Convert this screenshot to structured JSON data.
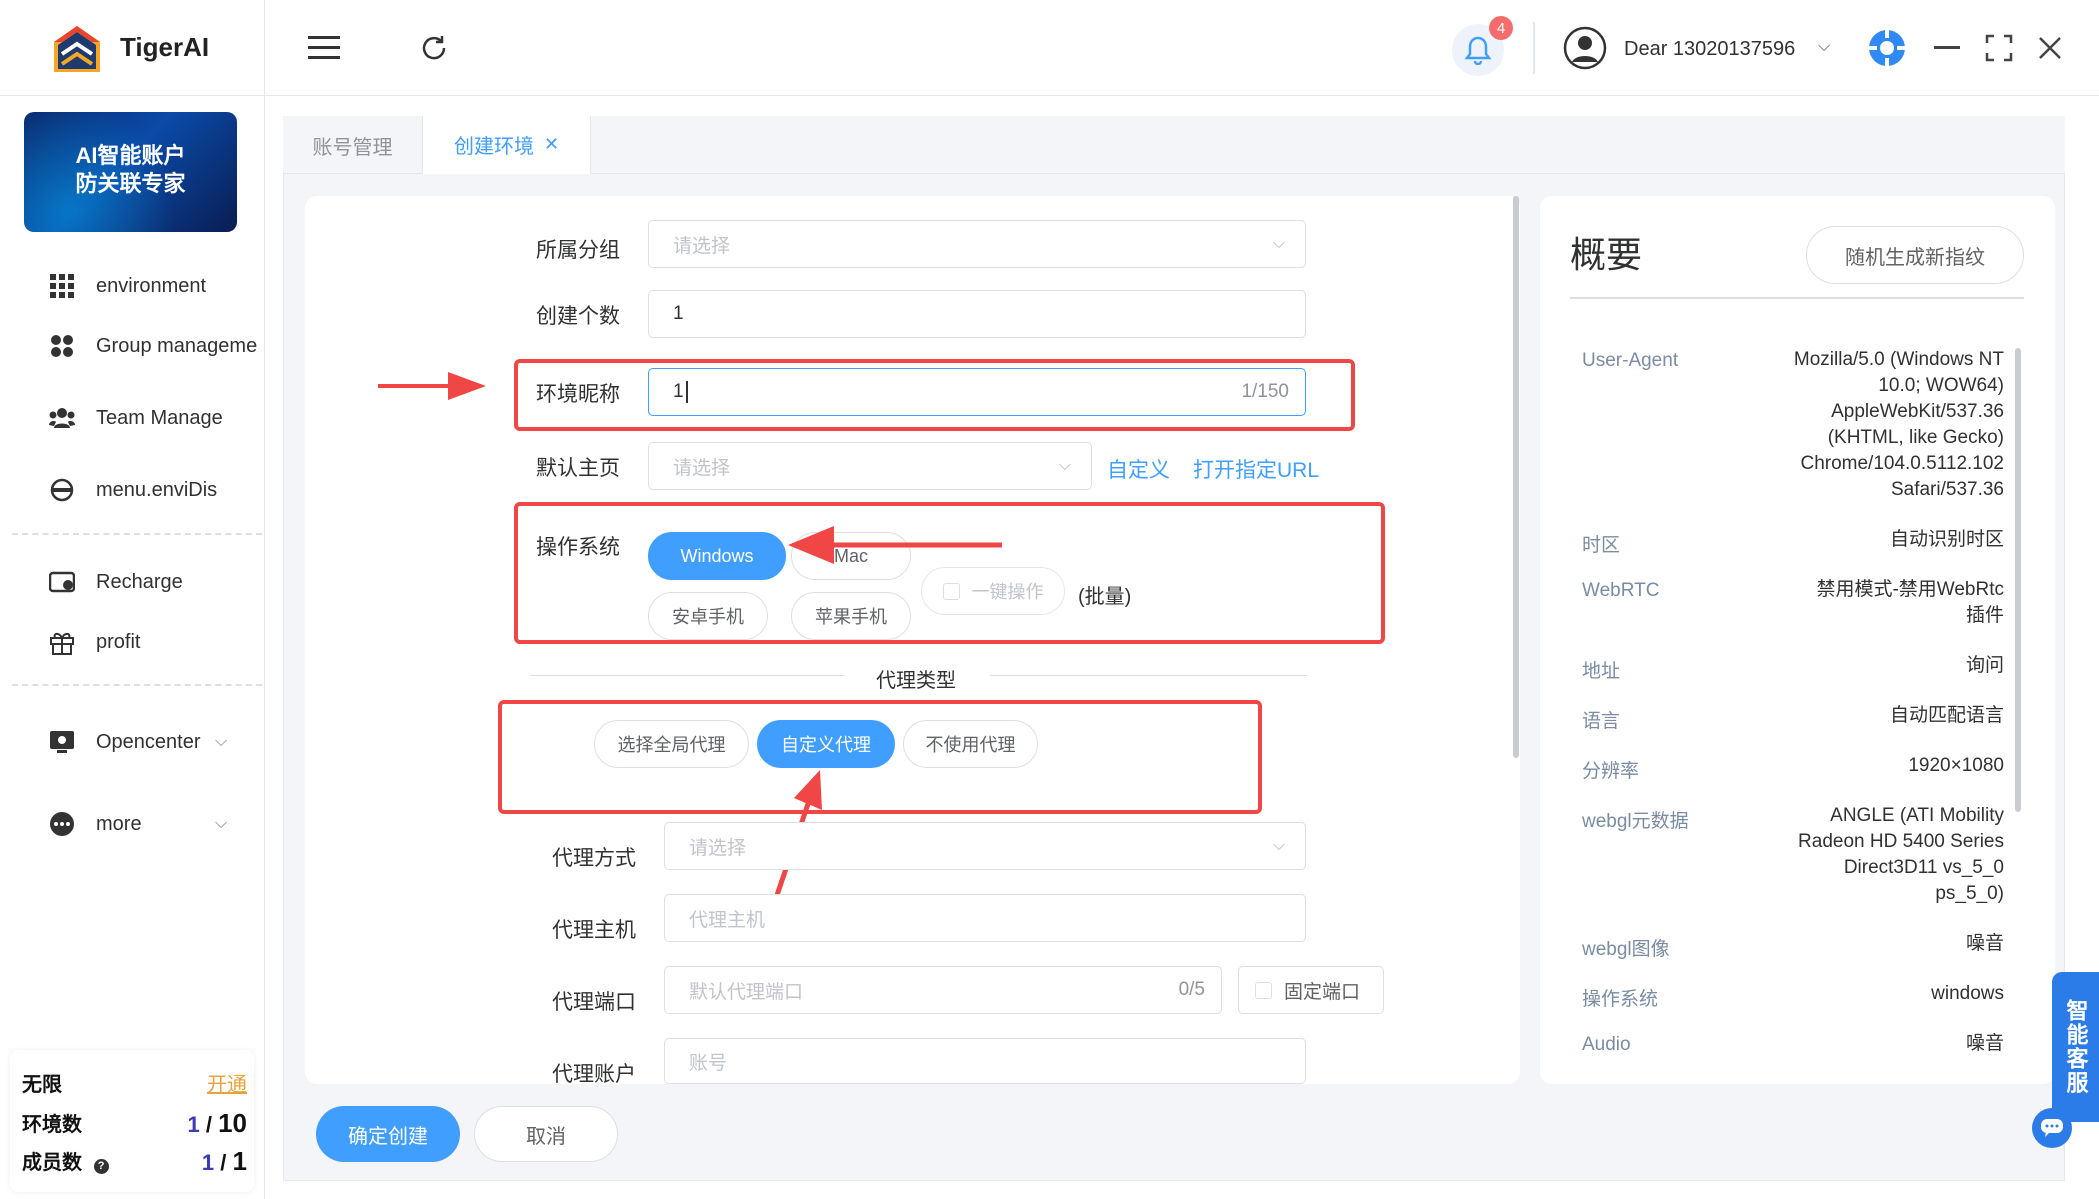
{
  "app": {
    "name": "TigerAI"
  },
  "topbar": {
    "notification_count": "4",
    "user_name": "Dear 13020137596"
  },
  "sidebar": {
    "banner_line1": "AI智能账户",
    "banner_line2": "防关联专家",
    "items": [
      {
        "label": "environment",
        "icon": "grid-icon"
      },
      {
        "label": "Group manageme",
        "icon": "group-icon"
      },
      {
        "label": "Team Manage",
        "icon": "team-icon"
      },
      {
        "label": "menu.enviDis",
        "icon": "globe-icon"
      },
      {
        "label": "Recharge",
        "icon": "wallet-icon"
      },
      {
        "label": "profit",
        "icon": "gift-icon"
      },
      {
        "label": "Opencenter",
        "icon": "api-icon"
      },
      {
        "label": "more",
        "icon": "more-icon"
      }
    ],
    "quota": {
      "plan": "无限",
      "open_link": "开通",
      "env_label": "环境数",
      "env_used": "1",
      "env_sep": "/",
      "env_total": "10",
      "member_label": "成员数",
      "member_used": "1",
      "member_sep": "/",
      "member_total": "1"
    }
  },
  "tabs": [
    {
      "label": "账号管理",
      "active": false
    },
    {
      "label": "创建环境",
      "active": true
    }
  ],
  "form": {
    "group": {
      "label": "所属分组",
      "placeholder": "请选择"
    },
    "count": {
      "label": "创建个数",
      "value": "1"
    },
    "nickname": {
      "label": "环境昵称",
      "value": "1",
      "counter": "1/150"
    },
    "homepage": {
      "label": "默认主页",
      "placeholder": "请选择",
      "link_custom": "自定义",
      "link_url": "打开指定URL"
    },
    "os": {
      "label": "操作系统",
      "options": [
        "Windows",
        "Mac",
        "安卓手机",
        "苹果手机"
      ],
      "selected": "Windows",
      "batch_checkbox": "一键操作",
      "batch_note": "(批量)"
    },
    "proxy_type": {
      "title": "代理类型",
      "options": [
        "选择全局代理",
        "自定义代理",
        "不使用代理"
      ],
      "selected": "自定义代理"
    },
    "proxy_method": {
      "label": "代理方式",
      "placeholder": "请选择"
    },
    "proxy_host": {
      "label": "代理主机",
      "placeholder": "代理主机"
    },
    "proxy_port": {
      "label": "代理端口",
      "placeholder": "默认代理端口",
      "counter": "0/5",
      "fixed_port": "固定端口"
    },
    "proxy_account": {
      "label": "代理账户",
      "placeholder": "账号"
    }
  },
  "actions": {
    "confirm": "确定创建",
    "cancel": "取消"
  },
  "summary": {
    "title": "概要",
    "regenerate": "随机生成新指纹",
    "rows": [
      {
        "key": "User-Agent",
        "value": "Mozilla/5.0 (Windows NT 10.0; WOW64) AppleWebKit/537.36 (KHTML, like Gecko) Chrome/104.0.5112.102 Safari/537.36"
      },
      {
        "key": "时区",
        "value": "自动识别时区"
      },
      {
        "key": "WebRTC",
        "value": "禁用模式-禁用WebRtc插件"
      },
      {
        "key": "地址",
        "value": "询问"
      },
      {
        "key": "语言",
        "value": "自动匹配语言"
      },
      {
        "key": "分辨率",
        "value": "1920×1080"
      },
      {
        "key": "webgl元数据",
        "value": "ANGLE (ATI Mobility Radeon HD 5400 Series Direct3D11 vs_5_0 ps_5_0)"
      },
      {
        "key": "webgl图像",
        "value": "噪音"
      },
      {
        "key": "操作系统",
        "value": "windows"
      },
      {
        "key": "Audio",
        "value": "噪音"
      }
    ]
  },
  "support_tab": "智能客服",
  "colors": {
    "primary": "#409eff",
    "annotation": "#f04646"
  }
}
